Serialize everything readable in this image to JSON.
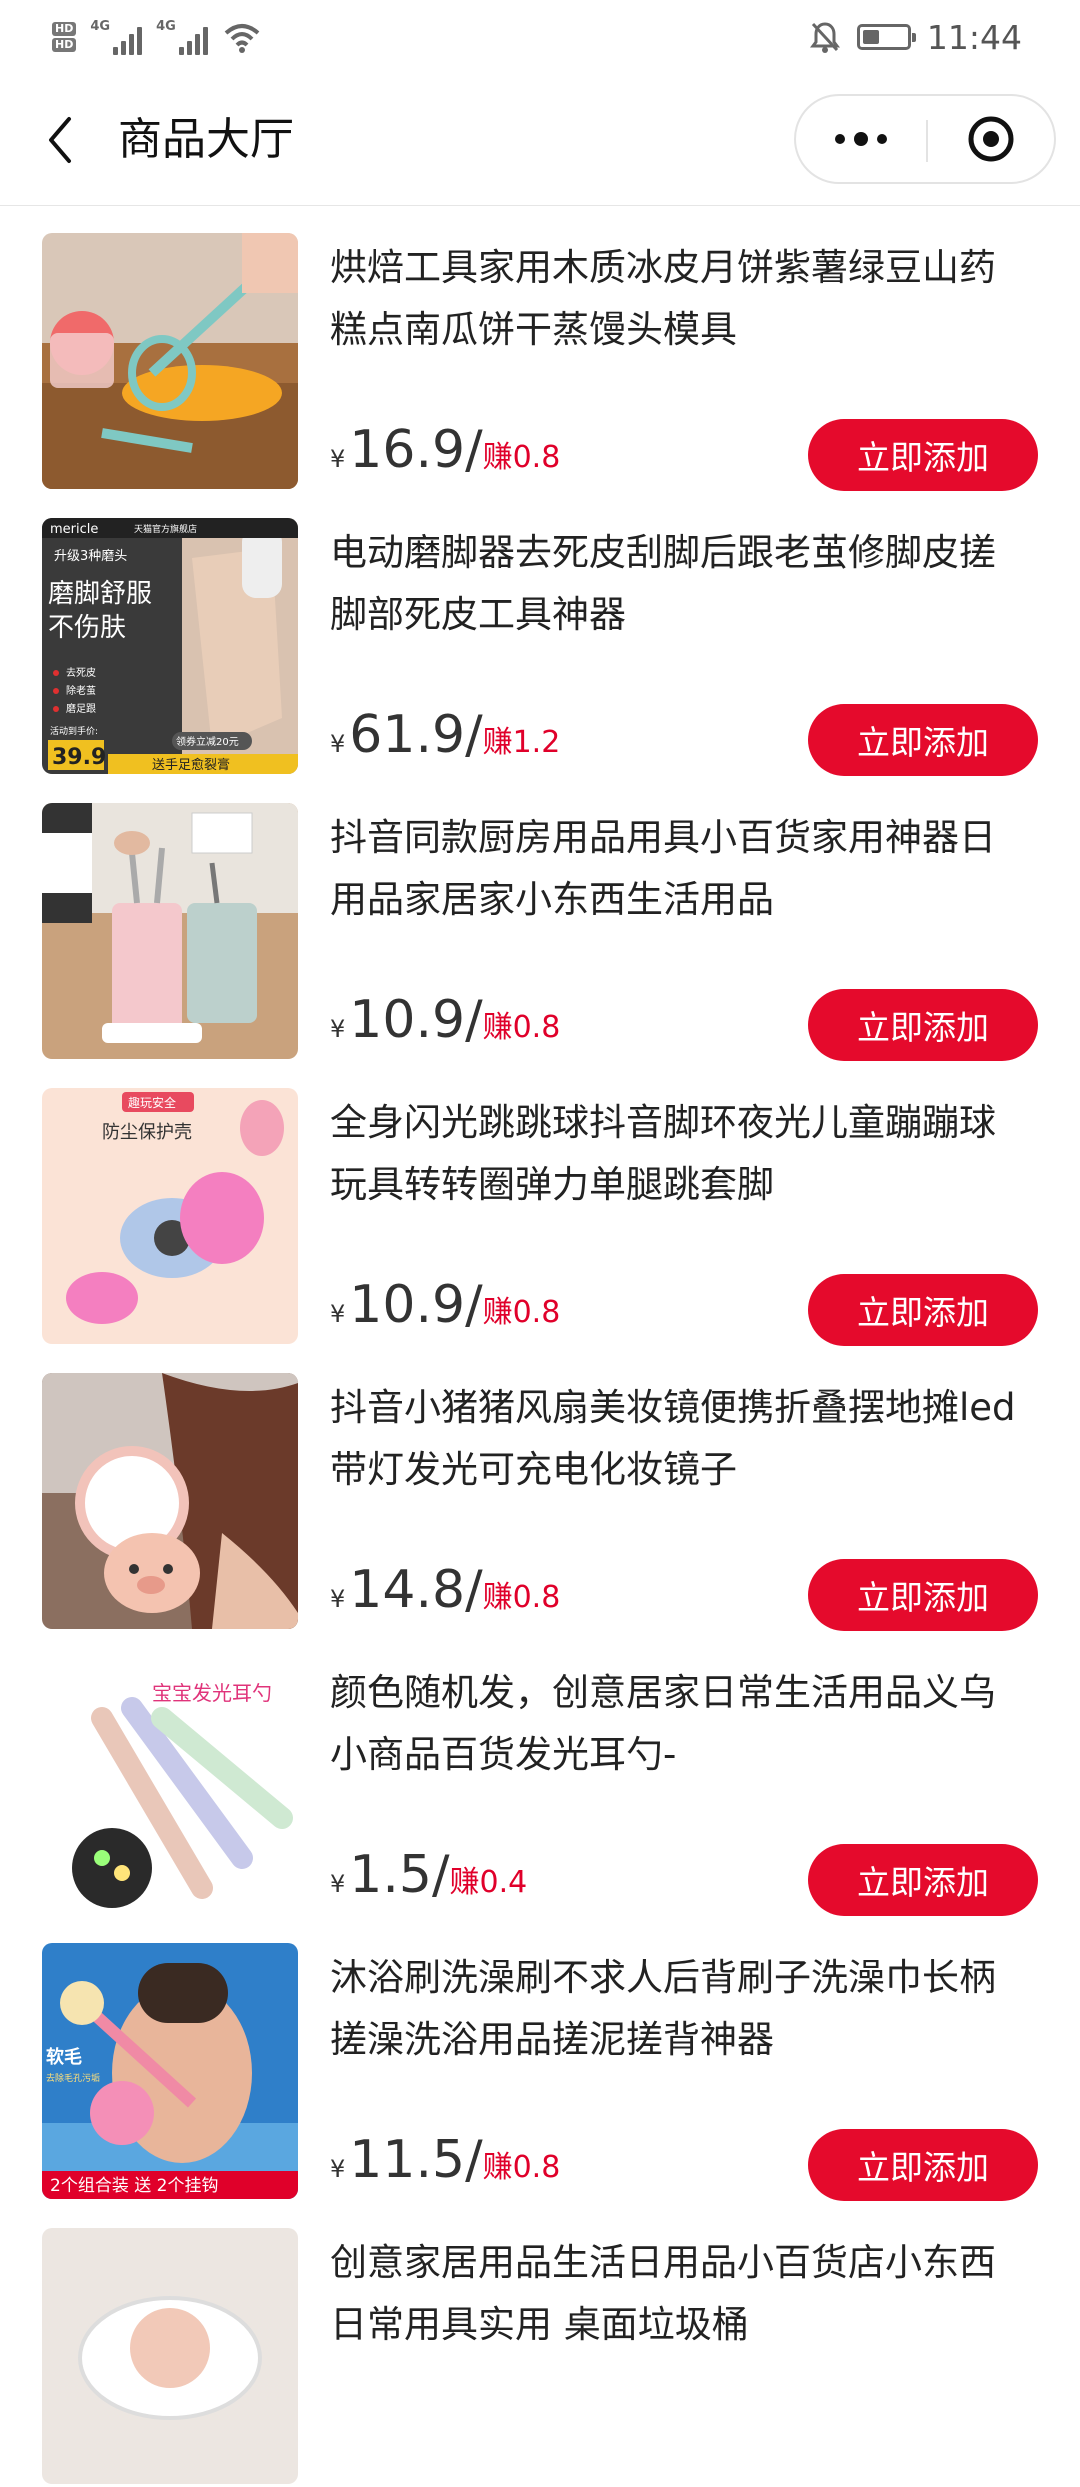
{
  "status_bar": {
    "hd1": "HD",
    "hd2": "HD",
    "net1": "4G",
    "net2": "4G",
    "time": "11:44",
    "icons": [
      "signal-icon",
      "wifi-icon",
      "mute-icon",
      "battery-icon"
    ]
  },
  "nav": {
    "title": "商品大厅",
    "back_icon": "chevron-left-icon",
    "more_icon": "more-dots-icon",
    "close_icon": "target-close-icon"
  },
  "currency_symbol": "¥",
  "add_label": "立即添加",
  "products": [
    {
      "title": "烘焙工具家用木质冰皮月饼紫薯绿豆山药糕点南瓜饼干蒸馒头模具",
      "price": "16.9",
      "earn": "赚0.8"
    },
    {
      "title": "电动磨脚器去死皮刮脚后跟老茧修脚皮搓脚部死皮工具神器",
      "price": "61.9",
      "earn": "赚1.2",
      "image_text": {
        "brand": "mericle",
        "shop": "天猫官方旗舰店",
        "tag": "升级3种磨头",
        "headline1": "磨脚舒服",
        "headline2": "不伤肤",
        "f1": "去死皮",
        "f2": "除老茧",
        "f3": "磨足跟",
        "price_label": "活动到手价:",
        "price": "39.9",
        "coupon": "领券立减20元",
        "gift": "送手足愈裂膏"
      }
    },
    {
      "title": "抖音同款厨房用品用具小百货家用神器日用品家居家小东西生活用品",
      "price": "10.9",
      "earn": "赚0.8"
    },
    {
      "title": "全身闪光跳跳球抖音脚环夜光儿童蹦蹦球玩具转转圈弹力单腿跳套脚",
      "price": "10.9",
      "earn": "赚0.8",
      "image_text": {
        "tag": "趣玩安全",
        "headline": "防尘保护壳"
      }
    },
    {
      "title": "抖音小猪猪风扇美妆镜便携折叠摆地摊led带灯发光可充电化妆镜子",
      "price": "14.8",
      "earn": "赚0.8"
    },
    {
      "title": "颜色随机发，创意居家日常生活用品义乌小商品百货发光耳勺-",
      "price": "1.5",
      "earn": "赚0.4",
      "image_text": {
        "headline": "宝宝发光耳勺"
      }
    },
    {
      "title": "沐浴刷洗澡刷不求人后背刷子洗澡巾长柄搓澡洗浴用品搓泥搓背神器",
      "price": "11.5",
      "earn": "赚0.8",
      "image_text": {
        "tag": "软毛",
        "sub": "去除毛孔污垢",
        "banner": "2个组合装 送 2个挂钩"
      }
    },
    {
      "title": "创意家居用品生活日用品小百货店小东西日常用具实用 桌面垃圾桶",
      "price": "",
      "earn": ""
    }
  ]
}
